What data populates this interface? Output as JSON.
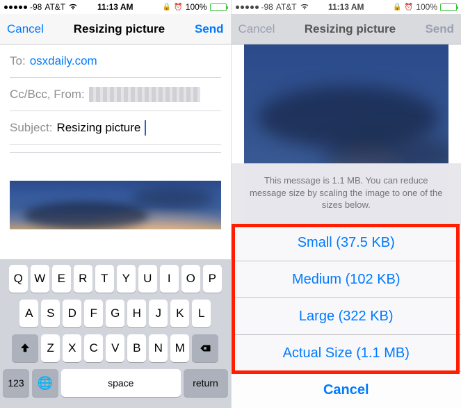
{
  "status": {
    "signal": "-98",
    "carrier": "AT&T",
    "time": "11:13 AM",
    "battery_pct": "100%",
    "alarm_glyph": "⏰",
    "lock_glyph": "🔒"
  },
  "compose": {
    "nav": {
      "cancel": "Cancel",
      "title": "Resizing picture",
      "send": "Send"
    },
    "to_label": "To:",
    "to_value": "osxdaily.com",
    "cc_label": "Cc/Bcc, From:",
    "subject_label": "Subject:",
    "subject_value": "Resizing picture"
  },
  "keyboard": {
    "row1": [
      "Q",
      "W",
      "E",
      "R",
      "T",
      "Y",
      "U",
      "I",
      "O",
      "P"
    ],
    "row2": [
      "A",
      "S",
      "D",
      "F",
      "G",
      "H",
      "J",
      "K",
      "L"
    ],
    "row3": [
      "Z",
      "X",
      "C",
      "V",
      "B",
      "N",
      "M"
    ],
    "numkey": "123",
    "space": "space",
    "return": "return"
  },
  "sheet": {
    "message": "This message is 1.1 MB. You can reduce message size by scaling the image to one of the sizes below.",
    "options": [
      "Small (37.5 KB)",
      "Medium (102 KB)",
      "Large (322 KB)",
      "Actual Size (1.1 MB)"
    ],
    "cancel": "Cancel"
  }
}
